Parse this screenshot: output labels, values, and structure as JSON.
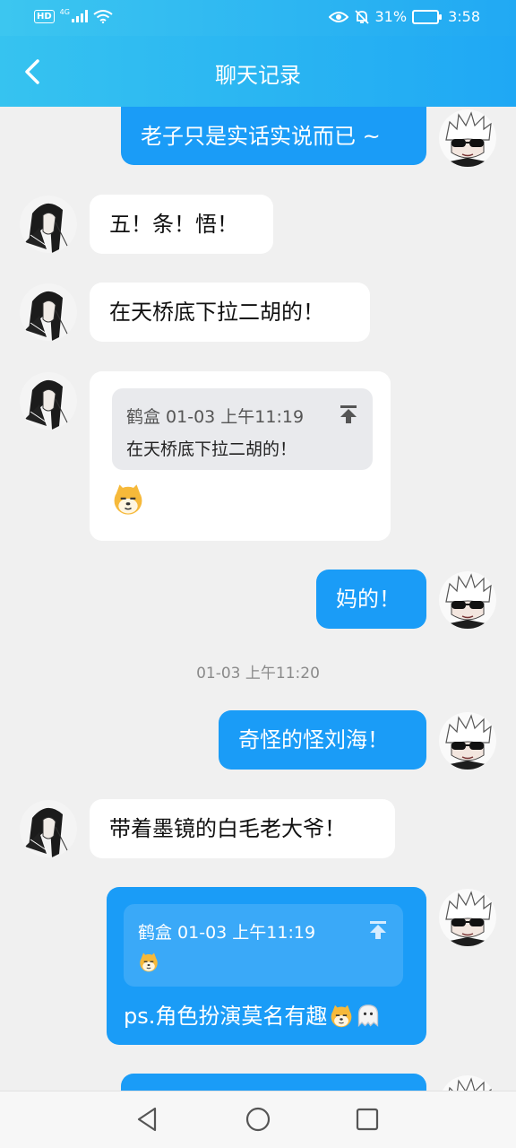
{
  "status_bar": {
    "network_type": "HD",
    "network_gen": "4G",
    "battery": "31%",
    "time": "3:58"
  },
  "header": {
    "title": "聊天记录",
    "back_icon": "chevron-left-icon"
  },
  "messages": {
    "m1": {
      "text": "老子只是实话实说而已 ~"
    },
    "m2": {
      "text": "五！条！悟！"
    },
    "m3": {
      "text": "在天桥底下拉二胡的！"
    },
    "m4": {
      "quote_sender_time": "鹤盒 01-03 上午11:19",
      "quote_text": "在天桥底下拉二胡的！",
      "sticker": "shiba-emoji"
    },
    "m5": {
      "text": "妈的！"
    },
    "timestamp": "01-03 上午11:20",
    "m6": {
      "text": "奇怪的怪刘海！"
    },
    "m7": {
      "text": "带着墨镜的白毛老大爷！"
    },
    "m8": {
      "quote_sender_time": "鹤盒 01-03 上午11:19",
      "quote_sticker": "shiba-emoji",
      "text": "ps.角色扮演莫名有趣"
    }
  },
  "colors": {
    "accent": "#1a9cf7",
    "header": "#21a9f3",
    "background": "#f0f0f0"
  },
  "nav": {
    "back": "triangle-back-icon",
    "home": "circle-home-icon",
    "recents": "square-recents-icon"
  }
}
